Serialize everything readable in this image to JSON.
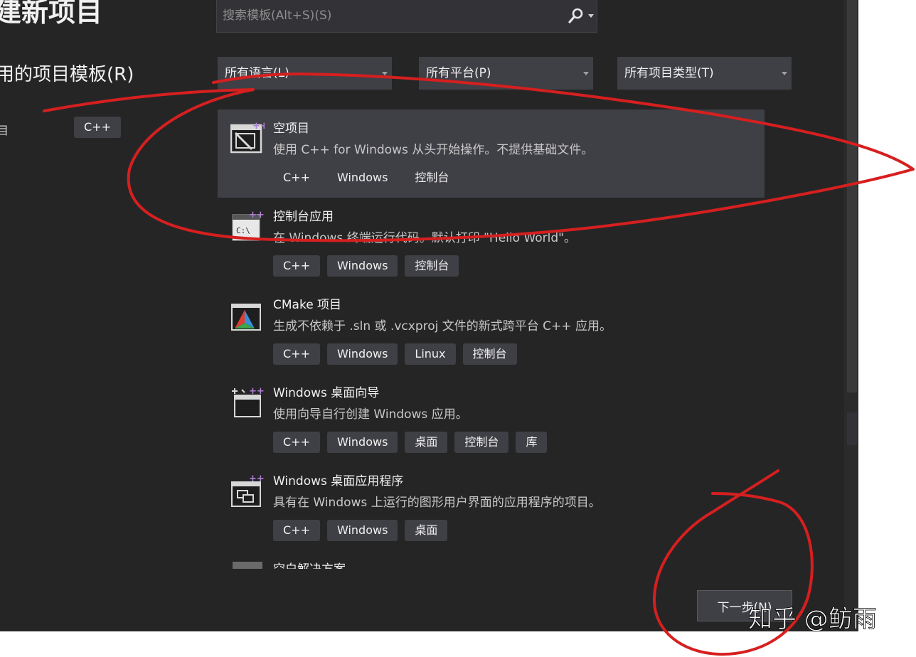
{
  "dialog": {
    "title": "建新项目",
    "recent_heading": "用的项目模板(R)",
    "recent_item": {
      "label": "目",
      "tag": "C++"
    }
  },
  "search": {
    "placeholder": "搜索模板(Alt+S)(S)",
    "value": ""
  },
  "filters": {
    "language": "所有语言(L)",
    "platform": "所有平台(P)",
    "project_type": "所有项目类型(T)"
  },
  "templates": [
    {
      "name": "空项目",
      "description": "使用 C++ for Windows 从头开始操作。不提供基础文件。",
      "tags": [
        "C++",
        "Windows",
        "控制台"
      ],
      "selected": true,
      "icon": "empty-project-icon"
    },
    {
      "name": "控制台应用",
      "description": "在 Windows 终端运行代码。默认打印 \"Hello World\"。",
      "tags": [
        "C++",
        "Windows",
        "控制台"
      ],
      "selected": false,
      "icon": "console-app-icon"
    },
    {
      "name": "CMake 项目",
      "description": "生成不依赖于 .sln 或 .vcxproj 文件的新式跨平台 C++ 应用。",
      "tags": [
        "C++",
        "Windows",
        "Linux",
        "控制台"
      ],
      "selected": false,
      "icon": "cmake-icon"
    },
    {
      "name": "Windows 桌面向导",
      "description": "使用向导自行创建 Windows 应用。",
      "tags": [
        "C++",
        "Windows",
        "桌面",
        "控制台",
        "库"
      ],
      "selected": false,
      "icon": "desktop-wizard-icon"
    },
    {
      "name": "Windows 桌面应用程序",
      "description": "具有在 Windows 上运行的图形用户界面的应用程序的项目。",
      "tags": [
        "C++",
        "Windows",
        "桌面"
      ],
      "selected": false,
      "icon": "desktop-app-icon"
    }
  ],
  "partial_template": {
    "name": "空白解决方案"
  },
  "buttons": {
    "next": "下一步(N)"
  },
  "watermark": {
    "text": "知乎 @鲂雨"
  },
  "colors": {
    "background": "#252526",
    "selected_row": "#3f3f46",
    "tag_bg": "#3f3f46",
    "accent_purple": "#b180d7",
    "annotation_red": "#d61f1f"
  }
}
